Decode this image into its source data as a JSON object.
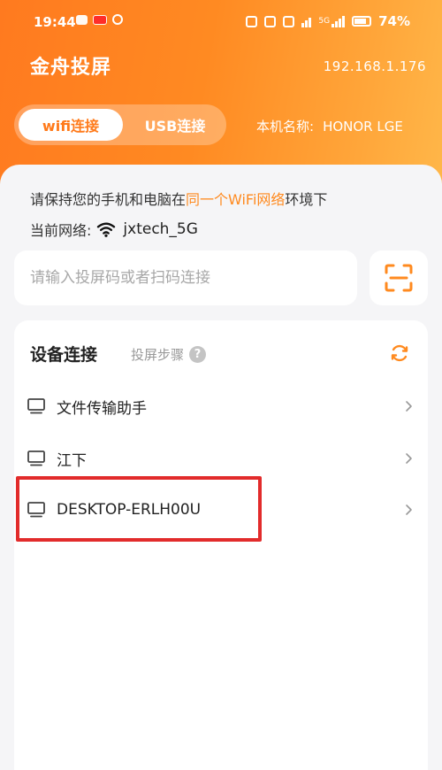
{
  "status_bar": {
    "time": "19:44",
    "signal_label": "5G",
    "battery": "74%"
  },
  "header": {
    "app_title": "金舟投屏",
    "ip_address": "192.168.1.176"
  },
  "connection_tabs": {
    "wifi": "wifi连接",
    "usb": "USB连接"
  },
  "device_info": {
    "label": "本机名称:",
    "name": "HONOR LGE"
  },
  "notice": {
    "prefix": "请保持您的手机和电脑在",
    "highlight": "同一个WiFi网络",
    "suffix": "环境下"
  },
  "network": {
    "label": "当前网络:",
    "ssid": "jxtech_5G"
  },
  "code_input": {
    "placeholder": "请输入投屏码或者扫码连接",
    "value": ""
  },
  "devices_section": {
    "title": "设备连接",
    "steps_label": "投屏步骤",
    "help_glyph": "?",
    "items": [
      {
        "label": "文件传输助手"
      },
      {
        "label": "江下"
      },
      {
        "label": "DESKTOP-ERLH00U"
      }
    ]
  },
  "colors": {
    "accent": "#ff7a1a",
    "highlight_text": "#ff8a1f",
    "annotation_box": "#e22b2b"
  },
  "icons": [
    "wifi-icon",
    "scan-icon",
    "help-icon",
    "refresh-icon",
    "computer-icon",
    "chevron-right-icon"
  ]
}
